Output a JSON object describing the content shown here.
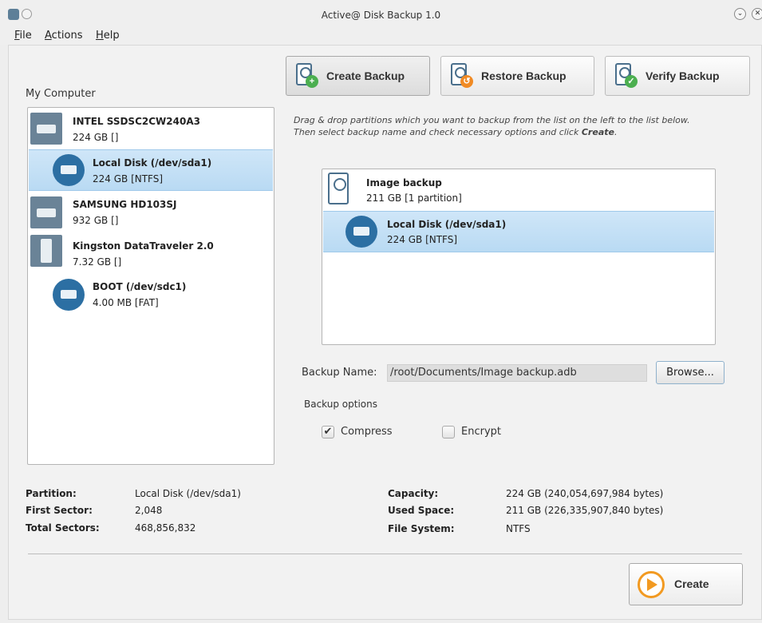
{
  "window": {
    "title": "Active@ Disk Backup 1.0",
    "minimize_glyph": "⌄",
    "close_glyph": "✕"
  },
  "menu": {
    "file": {
      "hotkey": "F",
      "rest": "ile"
    },
    "actions": {
      "hotkey": "A",
      "rest": "ctions"
    },
    "help": {
      "hotkey": "H",
      "rest": "elp"
    }
  },
  "tabs": [
    {
      "label": "Create Backup",
      "icon": "disk-add-icon",
      "badge": "+",
      "badge_color": "#4caf50"
    },
    {
      "label": "Restore Backup",
      "icon": "disk-restore-icon",
      "badge": "↺",
      "badge_color": "#f08a24"
    },
    {
      "label": "Verify Backup",
      "icon": "disk-verify-icon",
      "badge": "✓",
      "badge_color": "#4caf50"
    }
  ],
  "my_computer": {
    "label": "My Computer",
    "devices": [
      {
        "name": "INTEL SSDSC2CW240A3",
        "detail": "224 GB []",
        "icon": "hard-drive-icon"
      },
      {
        "name": "Local Disk (/dev/sda1)",
        "detail": "224 GB [NTFS]",
        "icon": "partition-icon"
      },
      {
        "name": "SAMSUNG HD103SJ",
        "detail": "932 GB []",
        "icon": "hard-drive-icon"
      },
      {
        "name": "Kingston DataTraveler 2.0",
        "detail": "7.32 GB []",
        "icon": "usb-drive-icon"
      },
      {
        "name": "BOOT (/dev/sdc1)",
        "detail": "4.00 MB [FAT]",
        "icon": "partition-icon"
      }
    ]
  },
  "instructions": {
    "line1": "Drag & drop partitions which you want to backup from the list on the left to the list below.",
    "line2_prefix": "Then select backup name and check necessary options and click ",
    "line2_action": "Create",
    "line2_suffix": "."
  },
  "backup_list": {
    "image": {
      "name": "Image backup",
      "detail": "211 GB [1 partition]"
    },
    "partition": {
      "name": "Local Disk (/dev/sda1)",
      "detail": "224 GB [NTFS]"
    }
  },
  "backup_name": {
    "label": "Backup Name:",
    "value": "/root/Documents/Image backup.adb",
    "browse": "Browse..."
  },
  "options": {
    "label": "Backup options",
    "compress": {
      "label": "Compress",
      "checked": true,
      "mark": "✔"
    },
    "encrypt": {
      "label": "Encrypt",
      "checked": false
    }
  },
  "details": {
    "partition": {
      "label": "Partition:",
      "value": "Local Disk (/dev/sda1)"
    },
    "first_sector": {
      "label": "First Sector:",
      "value": "2,048"
    },
    "total_sectors": {
      "label": "Total Sectors:",
      "value": "468,856,832"
    },
    "capacity": {
      "label": "Capacity:",
      "value": "224 GB (240,054,697,984 bytes)"
    },
    "used_space": {
      "label": "Used Space:",
      "value": "211 GB (226,335,907,840 bytes)"
    },
    "file_system": {
      "label": "File System:",
      "value": "NTFS"
    }
  },
  "create_button": {
    "label": "Create",
    "icon": "play-icon"
  },
  "colors": {
    "accent": "#2c6fa3",
    "selection": "#b9daf3",
    "create_icon": "#f29a22"
  }
}
